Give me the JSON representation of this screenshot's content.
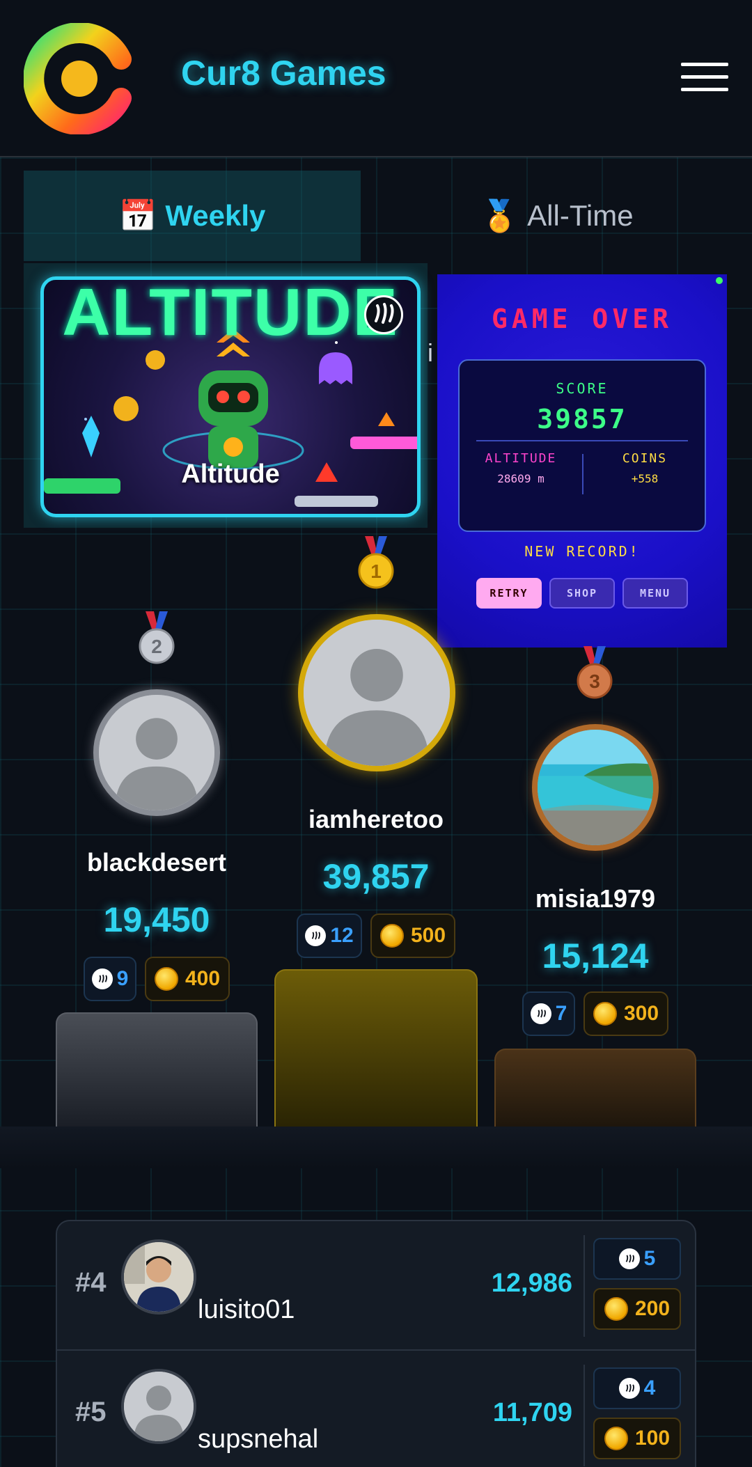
{
  "header": {
    "brand": "Cur8 Games",
    "logo_icon": "cur8-logo",
    "menu_icon": "hamburger-menu-icon"
  },
  "tabs": [
    {
      "label": "Weekly",
      "icon": "calendar-icon",
      "emoji": "📅",
      "active": true
    },
    {
      "label": "All-Time",
      "icon": "medal-icon",
      "emoji": "🏅",
      "active": false
    }
  ],
  "game_card": {
    "title": "ALTITUDE",
    "label": "Altitude"
  },
  "game_over": {
    "title": "GAME OVER",
    "score_label": "SCORE",
    "score": "39857",
    "altitude_label": "ALTITUDE",
    "altitude_value": "28609 m",
    "coins_label": "COINS",
    "coins_value": "+558",
    "record_text": "NEW RECORD!",
    "buttons": {
      "retry": "RETRY",
      "shop": "SHOP",
      "menu": "MENU"
    }
  },
  "stray_text": "i",
  "podium": {
    "first": {
      "place": "1",
      "name": "iamheretoo",
      "score": "39,857",
      "steem": "12",
      "coins": "500"
    },
    "second": {
      "place": "2",
      "name": "blackdesert",
      "score": "19,450",
      "steem": "9",
      "coins": "400"
    },
    "third": {
      "place": "3",
      "name": "misia1979",
      "score": "15,124",
      "steem": "7",
      "coins": "300"
    }
  },
  "list": [
    {
      "rank": "#4",
      "name": "luisito01",
      "score": "12,986",
      "steem": "5",
      "coins": "200"
    },
    {
      "rank": "#5",
      "name": "supsnehal",
      "score": "11,709",
      "steem": "4",
      "coins": "100"
    }
  ],
  "colors": {
    "accent": "#2fd4f0",
    "gold": "#d4a90a",
    "silver": "#8a8e96",
    "bronze": "#b06a2a",
    "coin": "#f2b21c",
    "steem": "#3aa0ff"
  }
}
